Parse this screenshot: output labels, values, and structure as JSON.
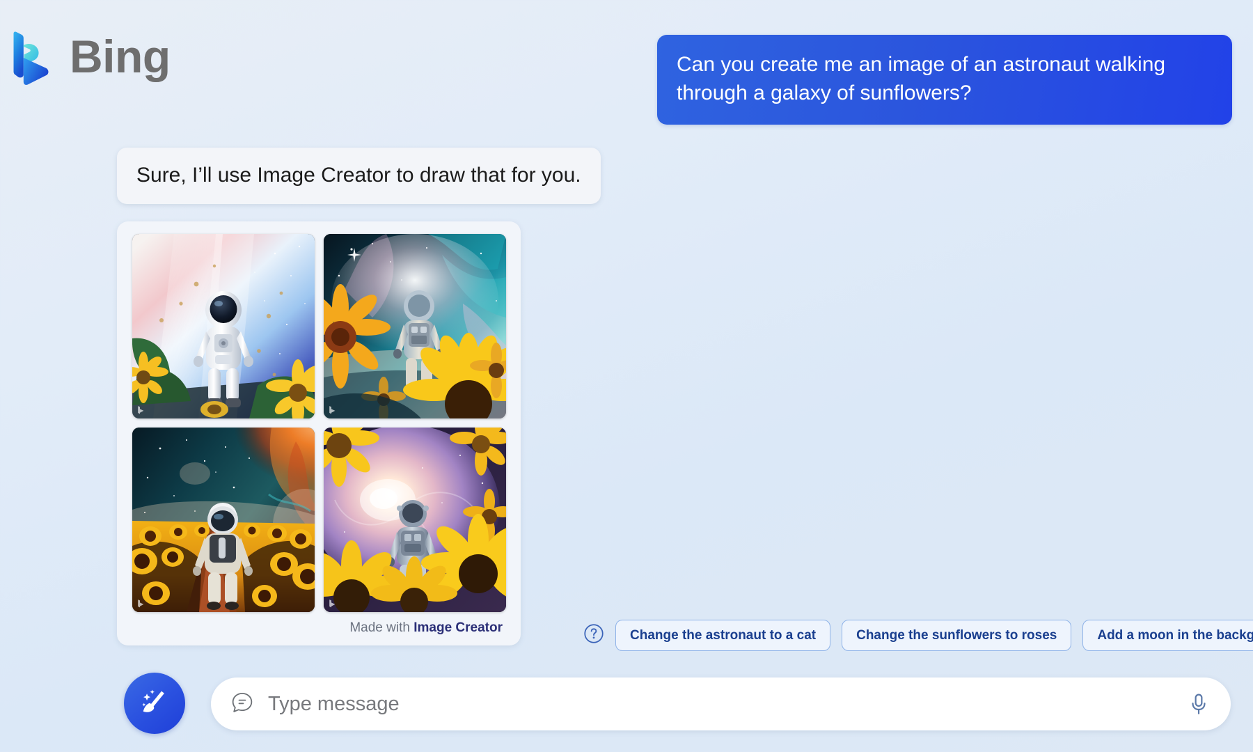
{
  "brand": {
    "name": "Bing",
    "logo_icon": "bing-logo-icon",
    "colors": {
      "logo_blue": "#1a8fe3",
      "logo_cyan": "#4fd6c8",
      "logo_deep": "#1452d6"
    }
  },
  "conversation": {
    "user_message": "Can you create me an image of an astronaut walking through a galaxy of sunflowers?",
    "assistant_message": "Sure, I’ll use Image Creator to draw that for you."
  },
  "image_results": {
    "attribution_prefix": "Made with",
    "attribution_link": "Image Creator",
    "watermark_icon": "bing-watermark-icon",
    "images": [
      {
        "alt": "Astronaut facing forward in a white suit with dark visor, pale pink and blue cosmic light behind, sunflowers and green leaves at bottom",
        "sky_top": "#f0e4ea",
        "sky_mid": "#cfe2f5",
        "sky_deep": "#2a3e8c",
        "accent": "#f7c94b"
      },
      {
        "alt": "Astronaut walking away into a teal and pink nebula with large sunflowers in the foreground",
        "sky_top": "#0d2230",
        "sky_mid": "#1e9aa8",
        "sky_deep": "#e8b6d8",
        "accent": "#f9c21c"
      },
      {
        "alt": "Astronaut walking away down a red dirt path through a dense sunflower field under an orange and teal nebula",
        "sky_top": "#102a33",
        "sky_mid": "#d95f2a",
        "sky_deep": "#0c3b45",
        "accent": "#f2a81b"
      },
      {
        "alt": "Astronaut walking toward a bright purple and pink spiral galaxy framed by sunflowers",
        "sky_top": "#2a1f45",
        "sky_mid": "#b98ad6",
        "sky_deep": "#f4e3d2",
        "accent": "#f7c215"
      }
    ]
  },
  "suggestions": {
    "help_icon": "question-mark-circle-icon",
    "chips": [
      "Change the astronaut to a cat",
      "Change the sunflowers to roses",
      "Add a moon in the background"
    ]
  },
  "composer": {
    "new_topic_icon": "broom-sparkle-icon",
    "message_icon": "chat-bubble-icon",
    "placeholder": "Type message",
    "value": "",
    "mic_icon": "microphone-icon"
  },
  "colors": {
    "accent_blue": "#2b52e0",
    "chip_border": "#8fb3e8",
    "chip_text": "#1a3f8f",
    "page_bg": "#dde8f6"
  }
}
